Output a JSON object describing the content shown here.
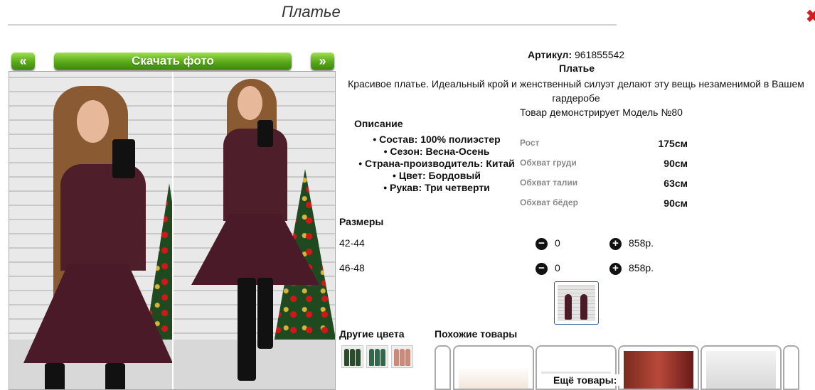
{
  "header": {
    "title": "Платье",
    "close_symbol": "✖"
  },
  "gallery": {
    "prev_label": "«",
    "next_label": "»",
    "download_label": "Скачать фото"
  },
  "product": {
    "article_label": "Артикул:",
    "article_value": "961855542",
    "name": "Платье",
    "description": "Красивое платье. Идеальный крой и женственный силуэт делают эту вещь незаменимой в Вашем гардеробе",
    "model_line": "Товар демонстрирует Модель №80"
  },
  "description": {
    "heading": "Описание",
    "items": [
      "Состав: 100% полиэстер",
      "Сезон: Весна-Осень",
      "Страна-производитель: Китай",
      "Цвет: Бордовый",
      "Рукав: Три четверти"
    ]
  },
  "measurements": [
    {
      "label": "Рост",
      "value": "175см"
    },
    {
      "label": "Обхват груди",
      "value": "90см"
    },
    {
      "label": "Обхват талии",
      "value": "63см"
    },
    {
      "label": "Обхват бёдер",
      "value": "90см"
    }
  ],
  "sizes": {
    "heading": "Размеры",
    "rows": [
      {
        "size": "42-44",
        "qty": "0",
        "price": "858р."
      },
      {
        "size": "46-48",
        "qty": "0",
        "price": "858р."
      }
    ],
    "minus_symbol": "−",
    "plus_symbol": "+"
  },
  "other_colors": {
    "heading": "Другие цвета",
    "swatches": [
      "#2e4a2e",
      "#2f6b4a",
      "#c98a7e"
    ]
  },
  "similar": {
    "heading": "Похожие товары",
    "more_label": "Ещё товары:"
  },
  "colors": {
    "accent_green": "#5aa81a",
    "dress_burgundy": "#4e1e2a",
    "close_red": "#d31f1f"
  }
}
